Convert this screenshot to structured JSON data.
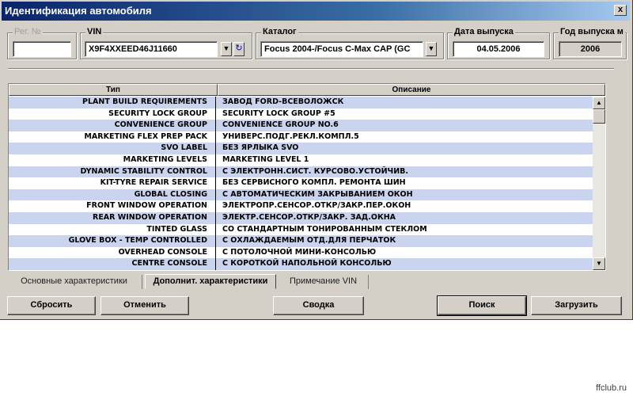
{
  "window": {
    "title": "Идентификация автомобиля",
    "close_glyph": "x"
  },
  "reg": {
    "label": "Рег. №",
    "value": ""
  },
  "vin": {
    "label": "VIN",
    "value": "X9F4XXEED46J11660"
  },
  "catalog": {
    "label": "Каталог",
    "value": "Focus 2004-/Focus C-Max CAP (GC"
  },
  "release_date": {
    "label": "Дата выпуска",
    "value": "04.05.2006"
  },
  "release_year": {
    "label": "Год выпуска м",
    "value": "2006"
  },
  "table": {
    "columns": [
      "Тип",
      "Описание"
    ],
    "rows": [
      [
        "PLANT BUILD REQUIREMENTS",
        "ЗАВОД FORD-ВСЕВОЛОЖСК"
      ],
      [
        "SECURITY LOCK GROUP",
        "SECURITY LOCK GROUP #5"
      ],
      [
        "CONVENIENCE GROUP",
        "CONVENIENCE GROUP NO.6"
      ],
      [
        "MARKETING FLEX PREP PACK",
        "УНИВЕРС.ПОДГ.РЕКЛ.КОМПЛ.5"
      ],
      [
        "SVO LABEL",
        "БЕЗ ЯРЛЫКА SVO"
      ],
      [
        "MARKETING LEVELS",
        "MARKETING LEVEL 1"
      ],
      [
        "DYNAMIC STABILITY CONTROL",
        "С ЭЛЕКТРОНН.СИСТ. КУРСОВО.УСТОЙЧИВ."
      ],
      [
        "KIT-TYRE REPAIR SERVICE",
        "БЕЗ СЕРВИСНОГО КОМПЛ. РЕМОНТА ШИН"
      ],
      [
        "GLOBAL CLOSING",
        "С АВТОМАТИЧЕСКИМ ЗАКРЫВАНИЕМ ОКОН"
      ],
      [
        "FRONT WINDOW OPERATION",
        "ЭЛЕКТРОПР.СЕНСОР.ОТКР/ЗАКР.ПЕР.ОКОН"
      ],
      [
        "REAR WINDOW OPERATION",
        "ЭЛЕКТР.СЕНСОР.ОТКР/ЗАКР. ЗАД.ОКНА"
      ],
      [
        "TINTED GLASS",
        "СО СТАНДАРТНЫМ ТОНИРОВАННЫМ СТЕКЛОМ"
      ],
      [
        "GLOVE BOX - TEMP CONTROLLED",
        "С ОХЛАЖДАЕМЫМ ОТД.ДЛЯ ПЕРЧАТОК"
      ],
      [
        "OVERHEAD CONSOLE",
        "С ПОТОЛОЧНОЙ МИНИ-КОНСОЛЬЮ"
      ],
      [
        "CENTRE CONSOLE",
        "С КОРОТКОЙ НАПОЛЬНОЙ КОНСОЛЬЮ"
      ]
    ]
  },
  "tabs": [
    "Основные характеристики",
    "Дополнит. характеристики",
    "Примечание VIN"
  ],
  "buttons": {
    "reset": "Сбросить",
    "cancel": "Отменить",
    "summary": "Сводка",
    "search": "Поиск",
    "load": "Загрузить"
  },
  "watermark": "ffclub.ru"
}
